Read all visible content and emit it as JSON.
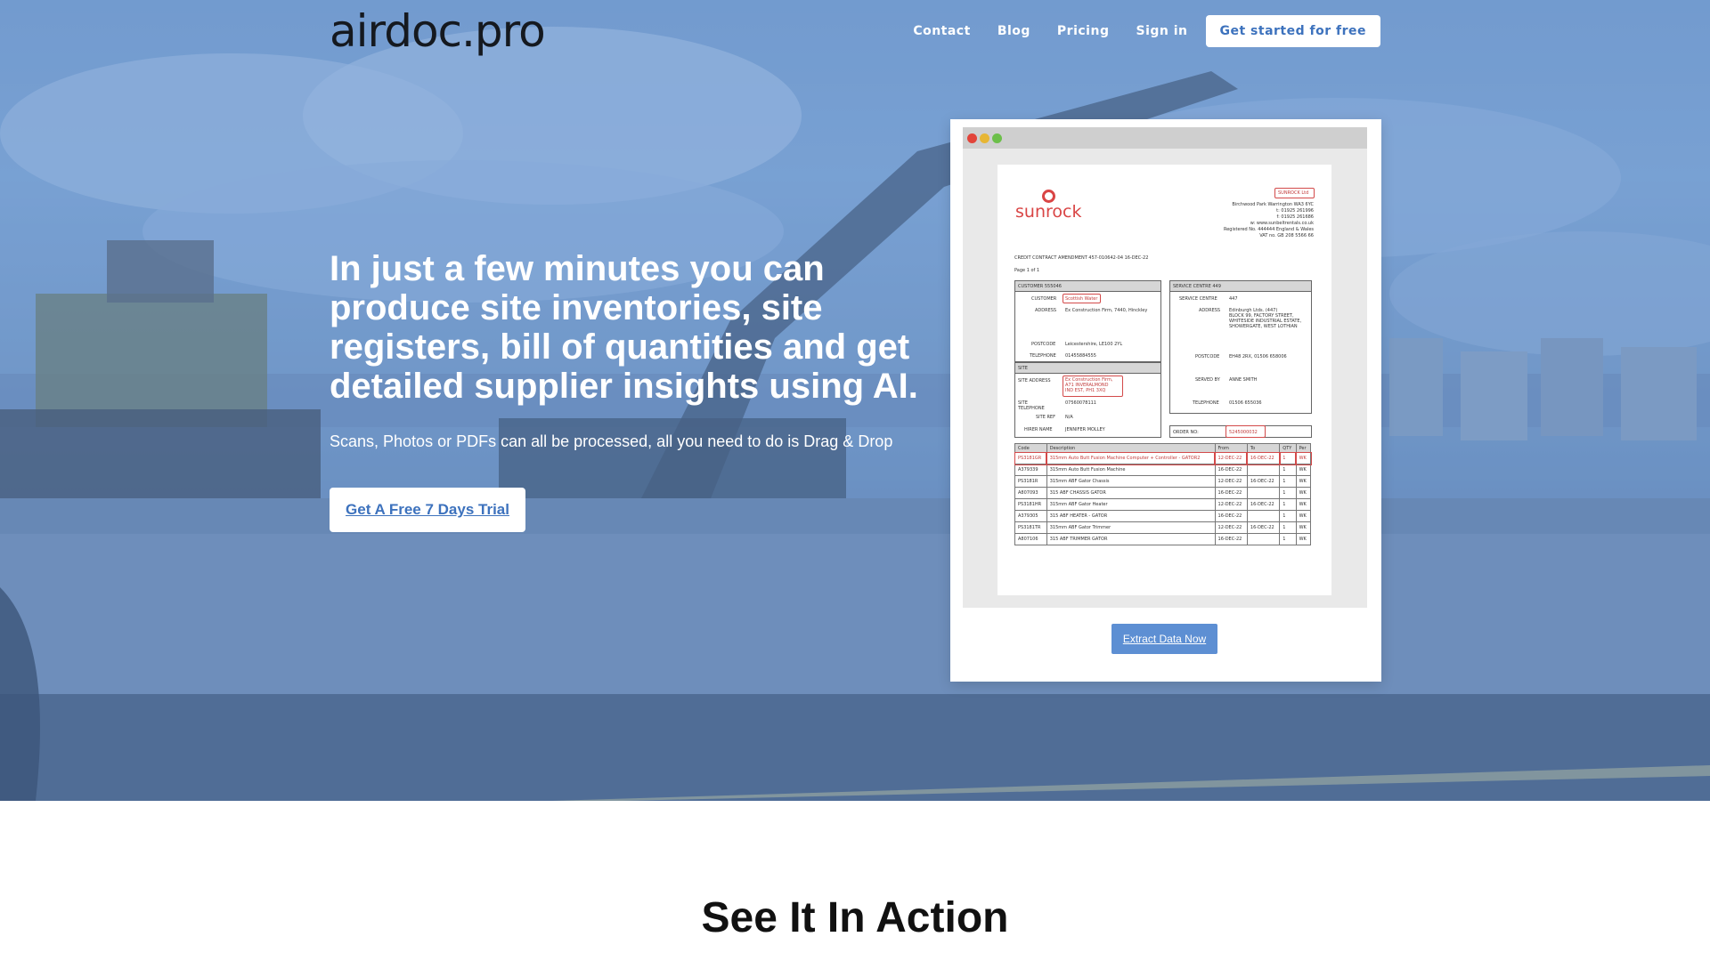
{
  "brand": {
    "logo_text": "airdoc.pro"
  },
  "nav": {
    "links": [
      "Contact",
      "Blog",
      "Pricing",
      "Sign in"
    ],
    "cta_label": "Get started for free"
  },
  "hero": {
    "headline": "In just a few minutes you can produce site inventories, site registers, bill of quantities and get detailed supplier insights using AI.",
    "subheadline": "Scans, Photos or PDFs can all be processed, all you need to do is Drag & Drop",
    "trial_button": "Get A Free 7 Days Trial"
  },
  "preview": {
    "extract_button": "Extract Data Now",
    "document": {
      "logo_word": "sunrock",
      "company_tag": "SUNROCK Ltd",
      "header_lines": [
        "Birchwood Park Warrington WA3 6YC",
        "t: 01925 261996",
        "f: 01925 261686",
        "w: www.sunbeltrentals.co.uk",
        "Registered No. 444444 England & Wales",
        "VAT no. GB 208 5566 66"
      ],
      "contract_line": "CREDIT CONTRACT AMENDMENT 457-010642-04 16-DEC-22",
      "page_line": "Page 1 of 1",
      "customer_head": "CUSTOMER 555046",
      "customer_name_label": "CUSTOMER",
      "customer_name": "Scottish Water",
      "address_label": "ADDRESS",
      "customer_address": "Ex Construction Firm, 7440, Hinckley",
      "postcode_label": "POSTCODE",
      "customer_postcode": "Leicestershire, LE100 2YL",
      "telephone_label": "TELEPHONE",
      "customer_phone": "01455884555",
      "service_head": "SERVICE CENTRE 449",
      "service_centre_label": "SERVICE CENTRE",
      "service_centre": "447",
      "service_address": [
        "Edinburgh Ltds. (447)",
        "BLOCK 99, FACTORY STREET,",
        "WHITESIDE INDUSTRIAL ESTATE,",
        "SHOWERGATE, WEST LOTHIAN"
      ],
      "service_postcode": "EH48 2RX, 01506 658006",
      "served_by_label": "SERVED BY",
      "served_by": "ANNE SMITH",
      "service_phone": "01506 655036",
      "site_head": "SITE",
      "site_address_label": "SITE ADDRESS",
      "site_address": [
        "Ex Construction Firm,",
        "A71 INVERALMOND",
        "IND EST, PH1 3XQ"
      ],
      "site_tel_label": "SITE TELEPHONE",
      "site_phone": "07560078111",
      "site_ref_label": "SITE REF",
      "site_ref": "N/A",
      "hirer_label": "HIRER NAME",
      "hirer": "JENNIFER MOLLEY",
      "order_label": "ORDER NO:",
      "order_no": "5245000032",
      "table_headers": [
        "Code",
        "Description",
        "From",
        "To",
        "QTY",
        "Per"
      ],
      "table_rows": [
        [
          "PS3181GR",
          "315mm Auto Butt Fusion Machine Computer + Controller - GATOR2",
          "12-DEC-22",
          "16-DEC-22",
          "1",
          "WK"
        ],
        [
          "A379339",
          "315mm Auto Butt Fusion Machine",
          "16-DEC-22",
          "",
          "1",
          "WK"
        ],
        [
          "PS3181R",
          "315mm ABF Gator Chassis",
          "12-DEC-22",
          "16-DEC-22",
          "1",
          "WK"
        ],
        [
          "A807093",
          "315 ABF CHASSIS GATOR",
          "16-DEC-22",
          "",
          "1",
          "WK"
        ],
        [
          "PS3181HR",
          "315mm ABF Gator Heater",
          "12-DEC-22",
          "16-DEC-22",
          "1",
          "WK"
        ],
        [
          "A379305",
          "315 ABF HEATER - GATOR",
          "16-DEC-22",
          "",
          "1",
          "WK"
        ],
        [
          "PS3181TR",
          "315mm ABF Gator Trimmer",
          "12-DEC-22",
          "16-DEC-22",
          "1",
          "WK"
        ],
        [
          "A807106",
          "315 ABF TRIMMER GATOR",
          "16-DEC-22",
          "",
          "1",
          "WK"
        ]
      ]
    }
  },
  "section": {
    "title": "See It In Action"
  },
  "colors": {
    "accent": "#3d72bd",
    "button_blue": "#5d8fd3",
    "highlight_red": "#d34a4a"
  }
}
